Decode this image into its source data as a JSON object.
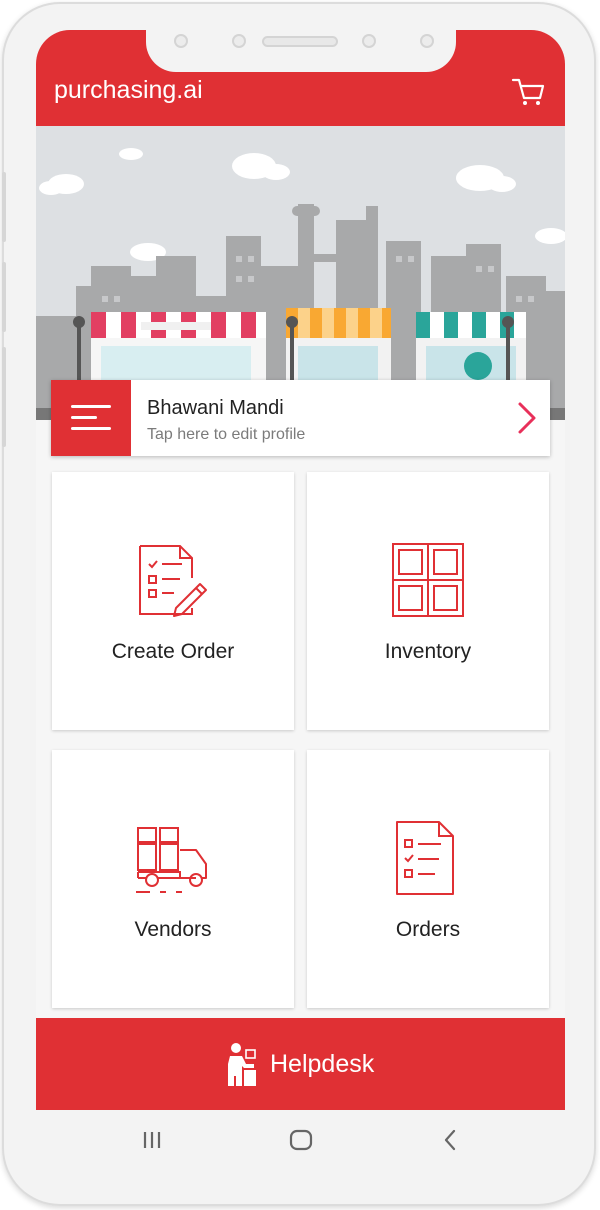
{
  "app": {
    "title": "purchasing.ai"
  },
  "profile": {
    "name": "Bhawani Mandi",
    "subtitle": "Tap here to edit profile"
  },
  "tiles": [
    {
      "label": "Create Order",
      "icon": "create-order-icon"
    },
    {
      "label": "Inventory",
      "icon": "inventory-icon"
    },
    {
      "label": "Vendors",
      "icon": "vendors-truck-icon"
    },
    {
      "label": "Orders",
      "icon": "orders-list-icon"
    }
  ],
  "helpdesk": {
    "label": "Helpdesk",
    "icon": "helpdesk-person-icon"
  },
  "colors": {
    "primary": "#e03034",
    "background": "#f6f6f6",
    "chevron": "#e8305a"
  },
  "navbar": {
    "icons": [
      "recents-icon",
      "home-icon",
      "back-icon"
    ]
  }
}
